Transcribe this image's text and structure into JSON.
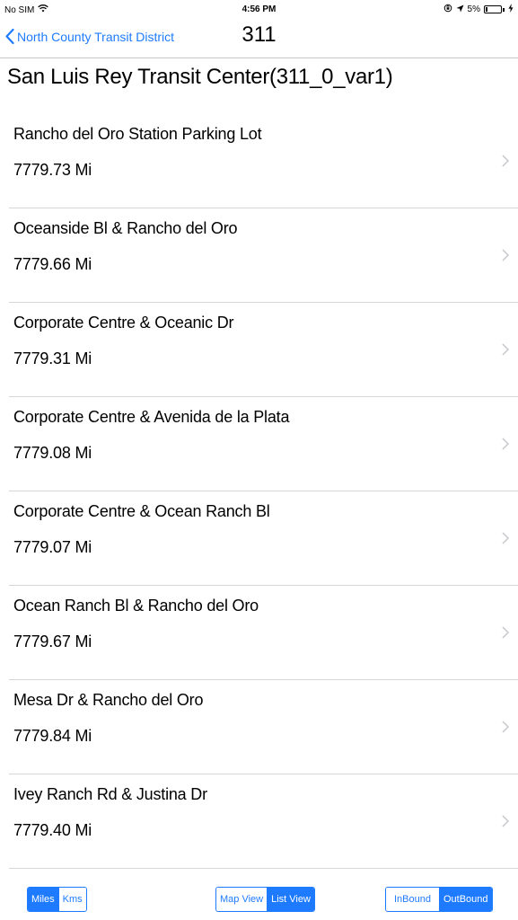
{
  "status_bar": {
    "carrier": "No SIM",
    "wifi_icon": "wifi-icon",
    "time": "4:56 PM",
    "lock_icon": "orientation-lock-icon",
    "location_icon": "location-arrow-icon",
    "battery_percent": "5%",
    "battery_level": 0.05,
    "charging_icon": "charging-bolt-icon"
  },
  "nav": {
    "back_label": "North County Transit District",
    "back_icon": "chevron-left-icon",
    "title": "311"
  },
  "route": {
    "title": "San Luis Rey Transit Center(311_0_var1)"
  },
  "stops": [
    {
      "name": "Rancho del Oro Station Parking Lot",
      "distance": "7779.73 Mi"
    },
    {
      "name": "Oceanside Bl & Rancho del Oro",
      "distance": "7779.66 Mi"
    },
    {
      "name": "Corporate Centre & Oceanic Dr",
      "distance": "7779.31 Mi"
    },
    {
      "name": "Corporate Centre & Avenida de la Plata",
      "distance": "7779.08 Mi"
    },
    {
      "name": "Corporate Centre & Ocean Ranch Bl",
      "distance": "7779.07 Mi"
    },
    {
      "name": "Ocean Ranch Bl & Rancho del Oro",
      "distance": "7779.67 Mi"
    },
    {
      "name": "Mesa Dr & Rancho del Oro",
      "distance": "7779.84 Mi"
    },
    {
      "name": "Ivey Ranch Rd & Justina Dr",
      "distance": "7779.40 Mi"
    }
  ],
  "toolbar": {
    "units": {
      "miles": "Miles",
      "kms": "Kms",
      "selected": "miles"
    },
    "view": {
      "map": "Map View",
      "list": "List View",
      "selected": "list"
    },
    "direction": {
      "inbound": "InBound",
      "outbound": "OutBound",
      "selected": "outbound"
    }
  },
  "colors": {
    "accent": "#1e7bff",
    "separator": "#d6d6d9",
    "chevron": "#c7c7cc"
  }
}
